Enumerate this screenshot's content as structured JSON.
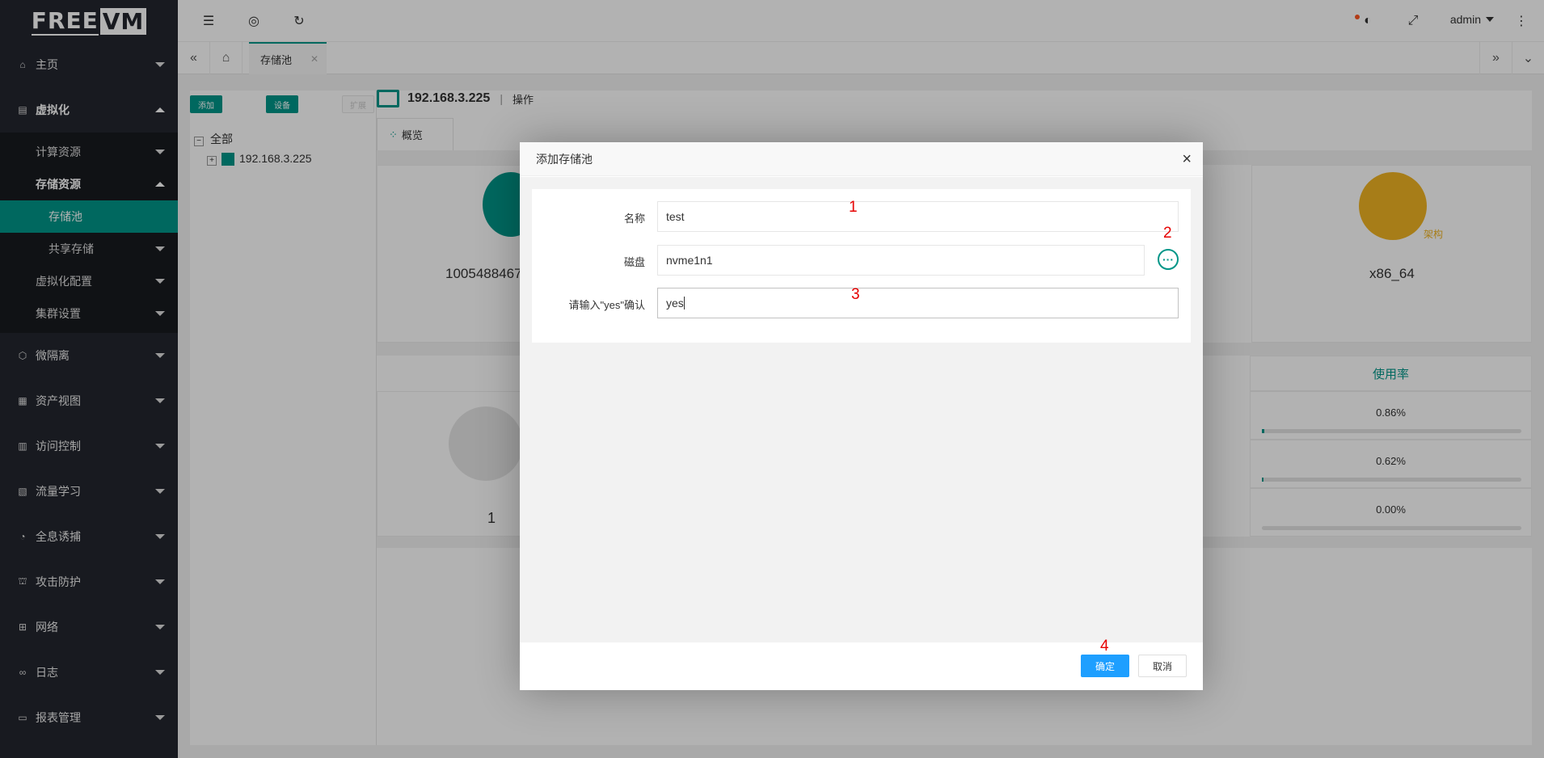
{
  "logo": {
    "part1": "FREE",
    "part2": "VM"
  },
  "sidebar": {
    "items": [
      {
        "label": "主页",
        "icon": "home-icon"
      },
      {
        "label": "虚拟化",
        "icon": "server-icon"
      },
      {
        "label": "微隔离",
        "icon": "cube-icon"
      },
      {
        "label": "资产视图",
        "icon": "asset-icon"
      },
      {
        "label": "访问控制",
        "icon": "grid-icon"
      },
      {
        "label": "流量学习",
        "icon": "book-icon"
      },
      {
        "label": "全息诱捕",
        "icon": "trap-icon"
      },
      {
        "label": "攻击防护",
        "icon": "shield-icon"
      },
      {
        "label": "网络",
        "icon": "network-icon"
      },
      {
        "label": "日志",
        "icon": "log-icon"
      },
      {
        "label": "报表管理",
        "icon": "report-icon"
      }
    ],
    "virtualization": {
      "compute": "计算资源",
      "storage": "存储资源",
      "storage_pool": "存储池",
      "shared_storage": "共享存储",
      "config": "虚拟化配置",
      "cluster": "集群设置"
    }
  },
  "header": {
    "user": "admin"
  },
  "tabs": {
    "active": "存储池"
  },
  "backdrop": {
    "btn_add": "添加",
    "btn_device": "设备",
    "btn_expand": "扩展",
    "tree_root": "全部",
    "tree_node": "192.168.3.225",
    "host_ip": "192.168.3.225",
    "host_sep": "|",
    "host_action": "操作",
    "tab_overview": "概览",
    "card_value_1": "1005488467",
    "card_value_arch": "x86_64",
    "arch_label": "架构",
    "usage_header": "使用率",
    "usage": [
      {
        "value": "0.86%",
        "fraction": 0.0086
      },
      {
        "value": "0.62%",
        "fraction": 0.0062
      },
      {
        "value": "0.00%",
        "fraction": 0
      }
    ],
    "pool_count": "1"
  },
  "modal": {
    "title": "添加存储池",
    "name_label": "名称",
    "name_value": "test",
    "disk_label": "磁盘",
    "disk_value": "nvme1n1",
    "confirm_label": "请输入\"yes\"确认",
    "confirm_value": "yes",
    "more_glyph": "···",
    "ok": "确定",
    "cancel": "取消",
    "annotations": [
      "1",
      "2",
      "3",
      "4"
    ]
  }
}
